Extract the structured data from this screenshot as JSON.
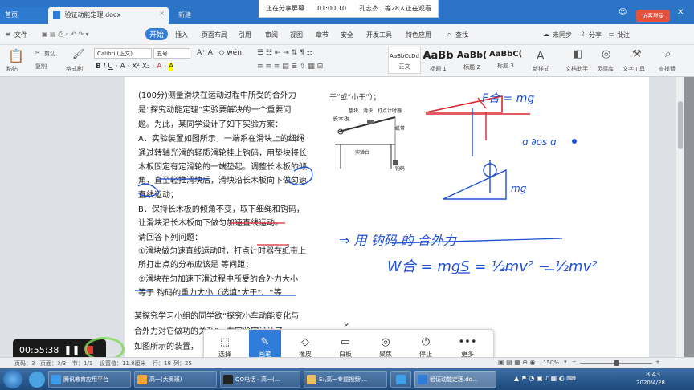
{
  "titlebar": {
    "tabs": [
      {
        "label": "首页"
      },
      {
        "label": "验证动能定理.docx"
      },
      {
        "label": "新建"
      }
    ],
    "share_banner": {
      "status": "正在分享屏幕",
      "time": "01:00:10",
      "viewers": "孔志杰...等28人正在观看"
    },
    "login_label": "访客登录"
  },
  "menubar": {
    "file": "文件",
    "items": [
      "开始",
      "插入",
      "页面布局",
      "引用",
      "审阅",
      "视图",
      "章节",
      "安全",
      "开发工具",
      "特色应用"
    ],
    "search": "查找",
    "right": [
      "未同步",
      "分享",
      "批注"
    ]
  },
  "ribbon": {
    "paste": "粘贴",
    "cut": "剪切",
    "copy": "复制",
    "format_painter": "格式刷",
    "font_name": "Calibri (正文)",
    "font_size": "五号",
    "styles": [
      {
        "preview": "AaBbCcDd",
        "label": "正文"
      },
      {
        "preview": "AaBb",
        "label": "标题 1"
      },
      {
        "preview": "AaBb(",
        "label": "标题 2"
      },
      {
        "preview": "AaBbC(",
        "label": "标题 3"
      }
    ],
    "new_style": "新样式",
    "tools": [
      "文档助手",
      "灵感库",
      "文字工具",
      "查找替"
    ]
  },
  "document": {
    "lines": [
      "(100分)测量滑块在运动过程中所受的合外力",
      "是“探究动能定理”实验要解决的一个重要问",
      "题。为此，某同学设计了如下实验方案：",
      "A．实验装置如图所示，一端系在滑块上的细绳",
      "通过转轴光滑的轻质滑轮挂上钩码，用垫块将长",
      "木板固定有定滑轮的一端垫起。调整长木板的倾",
      "角，直至轻推滑块后，滑块沿长木板向下做匀速",
      "直线运动；",
      "B．保持长木板的倾角不变，取下细绳和钩码，",
      "让滑块沿长木板向下做匀加速直线运动。",
      "请回答下列问题：",
      "①滑块做匀速直线运动时，打点计时器在纸带上",
      "所打出点的分布应该是 等间距；",
      "②滑块在匀加速下滑过程中所受的合外力大小",
      "等于 钩码的重力大小（选填“大于”、“等",
      "某探究学习小组的同学欲“探究小车动能变化与",
      "合外力对它做功的关系”，在实验室设计了",
      "如图所示的装置，"
    ],
    "right_text": "于”或“小于”）；",
    "figure_labels": {
      "board": "长木板",
      "pad": "垫块",
      "slider": "滑块",
      "timer": "打点计时器",
      "tape": "纸带",
      "table": "实验台",
      "weight": "钩码"
    },
    "handwriting": {
      "formula_top": "F合 = mg",
      "cos_note": "ɑ ∂os ɑ",
      "mg_label": "mg",
      "arrow_text": "⇒ 用 钩码 的 合外力",
      "work_eq": "W合 = mgS = ½mv² − ½mv²"
    }
  },
  "recorder": {
    "time": "00:55:38"
  },
  "drawbar": {
    "tools": [
      {
        "label": "选择",
        "icon": "cursor-icon"
      },
      {
        "label": "画笔",
        "icon": "pen-icon"
      },
      {
        "label": "橡皮",
        "icon": "eraser-icon"
      },
      {
        "label": "白板",
        "icon": "whiteboard-icon"
      },
      {
        "label": "聚焦",
        "icon": "focus-icon"
      },
      {
        "label": "停止",
        "icon": "stop-icon"
      },
      {
        "label": "更多",
        "icon": "more-icon"
      }
    ]
  },
  "statusbar": {
    "page": "页码：3",
    "pages": "页面：3/3",
    "section": "节：1/1",
    "setting": "设置值：11.8厘米",
    "row": "行：18",
    "col": "列：25",
    "zoom": "150%"
  },
  "taskbar": {
    "items": [
      "腾讯教育应用平台",
      "高一(大奥班)",
      "QQ电话 - 高一(...",
      "E:\\高一专题视频\\...",
      "验证动能定理.do..."
    ],
    "clock_time": "8:43",
    "clock_date": "2020/4/28"
  },
  "colors": {
    "accent": "#2f7dd8",
    "titlebar": "#2b74c6",
    "ink_blue": "#1d4fd6",
    "ink_red": "#d7262e",
    "taskbar": "#1e4a7c"
  }
}
